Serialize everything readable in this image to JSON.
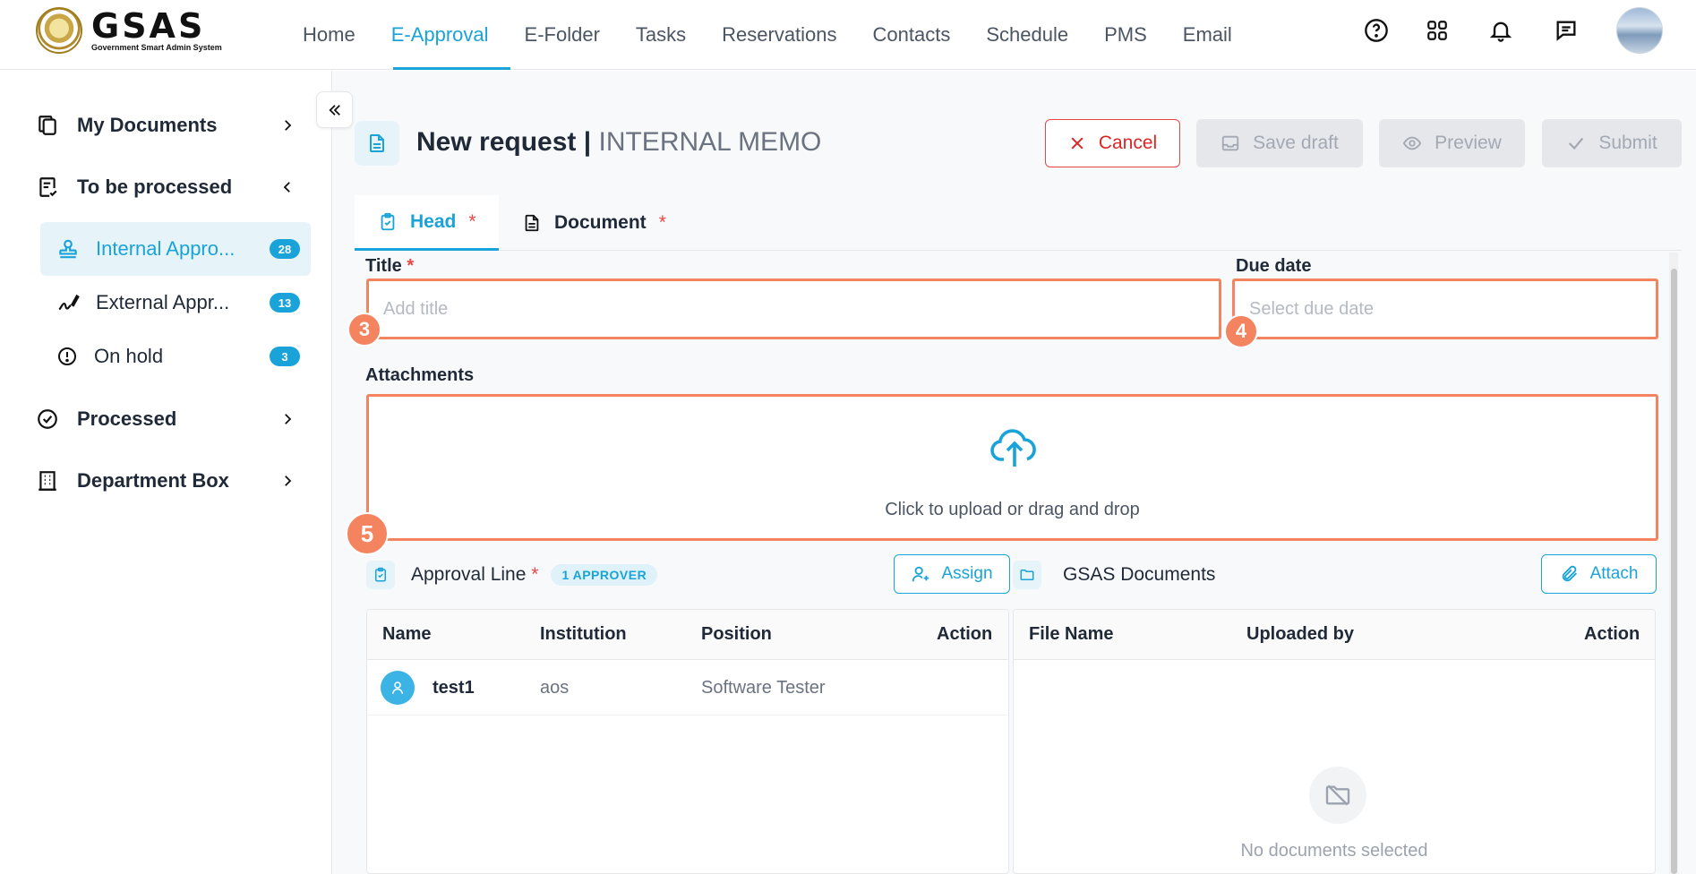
{
  "app": {
    "logo_title": "GSAS",
    "logo_subtitle": "Government Smart Admin System"
  },
  "nav": {
    "items": [
      "Home",
      "E-Approval",
      "E-Folder",
      "Tasks",
      "Reservations",
      "Contacts",
      "Schedule",
      "PMS",
      "Email"
    ],
    "active": "E-Approval"
  },
  "top_icons": [
    "help-icon",
    "apps-grid-icon",
    "bell-icon",
    "chat-icon"
  ],
  "sidebar": {
    "my_documents": "My Documents",
    "to_be_processed": "To be processed",
    "sub_items": [
      {
        "label": "Internal Appro...",
        "count": "28"
      },
      {
        "label": "External Appr...",
        "count": "13"
      },
      {
        "label": "On hold",
        "count": "3"
      }
    ],
    "processed": "Processed",
    "department_box": "Department Box"
  },
  "page": {
    "title": "New request",
    "separator": "|",
    "subtitle": "INTERNAL MEMO"
  },
  "actions": {
    "cancel": "Cancel",
    "save_draft": "Save draft",
    "preview": "Preview",
    "submit": "Submit"
  },
  "tabs": {
    "head": "Head",
    "document": "Document",
    "required_mark": "*"
  },
  "form": {
    "title_label": "Title",
    "title_placeholder": "Add title",
    "due_label": "Due date",
    "due_placeholder": "Select due date",
    "attachments_label": "Attachments",
    "upload_text": "Click to upload or drag and drop",
    "required_mark": "*"
  },
  "markers": [
    "3",
    "4",
    "5"
  ],
  "approval": {
    "title": "Approval Line",
    "required_mark": "*",
    "count_pill": "1 APPROVER",
    "assign": "Assign",
    "columns": [
      "Name",
      "Institution",
      "Position",
      "Action"
    ],
    "rows": [
      {
        "name": "test1",
        "institution": "aos",
        "position": "Software Tester"
      }
    ]
  },
  "documents": {
    "title": "GSAS Documents",
    "attach": "Attach",
    "columns": [
      "File Name",
      "Uploaded by",
      "Action"
    ],
    "empty": "No documents selected"
  },
  "colors": {
    "accent": "#1aa3d9",
    "highlight": "#f4845f",
    "danger": "#dc2626"
  }
}
